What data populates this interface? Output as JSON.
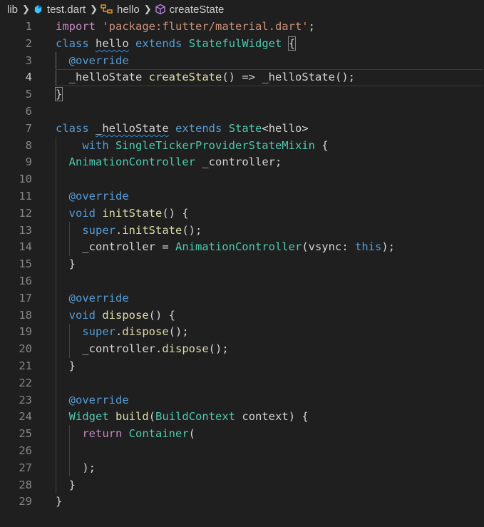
{
  "breadcrumb": {
    "folder": "lib",
    "file": "test.dart",
    "class": "hello",
    "method": "createState"
  },
  "line_numbers": [
    "1",
    "2",
    "3",
    "4",
    "5",
    "6",
    "7",
    "8",
    "9",
    "10",
    "11",
    "12",
    "13",
    "14",
    "15",
    "16",
    "17",
    "18",
    "19",
    "20",
    "21",
    "22",
    "23",
    "24",
    "25",
    "26",
    "27",
    "28",
    "29"
  ],
  "code": {
    "l1": {
      "a": "import",
      "b": " ",
      "c": "'package:flutter/material.dart'",
      "d": ";"
    },
    "l2": {
      "a": "class",
      "b": " ",
      "c": "hello",
      "d": " ",
      "e": "extends",
      "f": " ",
      "g": "StatefulWidget",
      "h": " ",
      "i": "{"
    },
    "l3": {
      "a": "  ",
      "b": "@override"
    },
    "l4": {
      "a": "  ",
      "b": "_helloState",
      "c": " ",
      "d": "createState",
      "e": "() => ",
      "f": "_helloState",
      "g": "();"
    },
    "l5": {
      "a": "}"
    },
    "l7": {
      "a": "class",
      "b": " ",
      "c": "_helloState",
      "d": " ",
      "e": "extends",
      "f": " ",
      "g": "State",
      "h": "<",
      "i": "hello",
      "j": ">"
    },
    "l8": {
      "a": "    ",
      "b": "with",
      "c": " ",
      "d": "SingleTickerProviderStateMixin",
      "e": " {"
    },
    "l9": {
      "a": "  ",
      "b": "AnimationController",
      "c": " ",
      "d": "_controller",
      "e": ";"
    },
    "l11": {
      "a": "  ",
      "b": "@override"
    },
    "l12": {
      "a": "  ",
      "b": "void",
      "c": " ",
      "d": "initState",
      "e": "() {"
    },
    "l13": {
      "a": "    ",
      "b": "super",
      "c": ".",
      "d": "initState",
      "e": "();"
    },
    "l14": {
      "a": "    ",
      "b": "_controller",
      "c": " = ",
      "d": "AnimationController",
      "e": "(",
      "f": "vsync",
      "g": ": ",
      "h": "this",
      "i": ");"
    },
    "l15": {
      "a": "  }"
    },
    "l17": {
      "a": "  ",
      "b": "@override"
    },
    "l18": {
      "a": "  ",
      "b": "void",
      "c": " ",
      "d": "dispose",
      "e": "() {"
    },
    "l19": {
      "a": "    ",
      "b": "super",
      "c": ".",
      "d": "dispose",
      "e": "();"
    },
    "l20": {
      "a": "    ",
      "b": "_controller",
      "c": ".",
      "d": "dispose",
      "e": "();"
    },
    "l21": {
      "a": "  }"
    },
    "l23": {
      "a": "  ",
      "b": "@override"
    },
    "l24": {
      "a": "  ",
      "b": "Widget",
      "c": " ",
      "d": "build",
      "e": "(",
      "f": "BuildContext",
      "g": " ",
      "h": "context",
      "i": ") {"
    },
    "l25": {
      "a": "    ",
      "b": "return",
      "c": " ",
      "d": "Container",
      "e": "("
    },
    "l27": {
      "a": "    );"
    },
    "l28": {
      "a": "  }"
    },
    "l29": {
      "a": "}"
    }
  },
  "colors": {
    "background": "#1f1f1f",
    "keyword": "#569cd6",
    "control": "#c586c0",
    "string": "#ce9178",
    "type": "#4ec9b0",
    "function": "#dcdcaa",
    "variable": "#9cdcfe",
    "line_number": "#858585"
  },
  "icons": {
    "file": "dart-file-icon",
    "class": "class-symbol-icon",
    "method": "method-cube-icon",
    "separator": "chevron-right-icon"
  }
}
